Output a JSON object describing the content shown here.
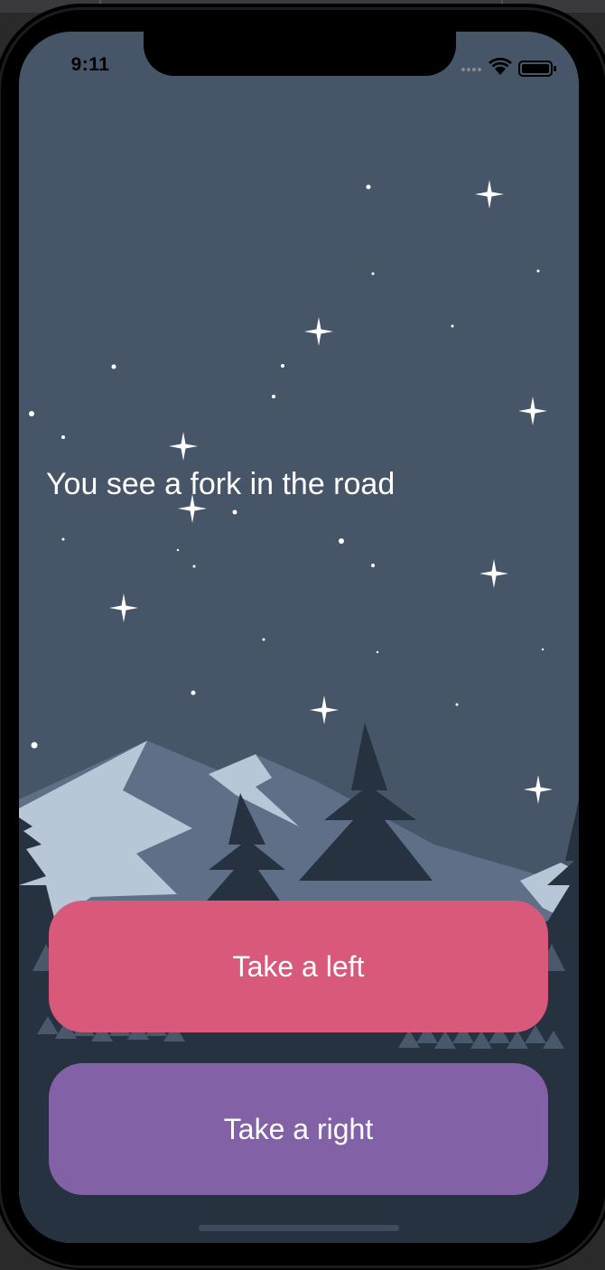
{
  "status_bar": {
    "time": "9:11",
    "icons": [
      "cellular-signal-icon",
      "wifi-icon",
      "battery-icon"
    ]
  },
  "story": {
    "text": "You see a fork in the road"
  },
  "choices": {
    "left_label": "Take a left",
    "right_label": "Take a right"
  },
  "colors": {
    "sky": "#475569",
    "choice_left": "#d9597a",
    "choice_right": "#8261a6",
    "text": "#ffffff",
    "mountain_light": "#b7c7d7",
    "mountain_mid": "#5f6f87",
    "tree_dark": "#263240"
  }
}
